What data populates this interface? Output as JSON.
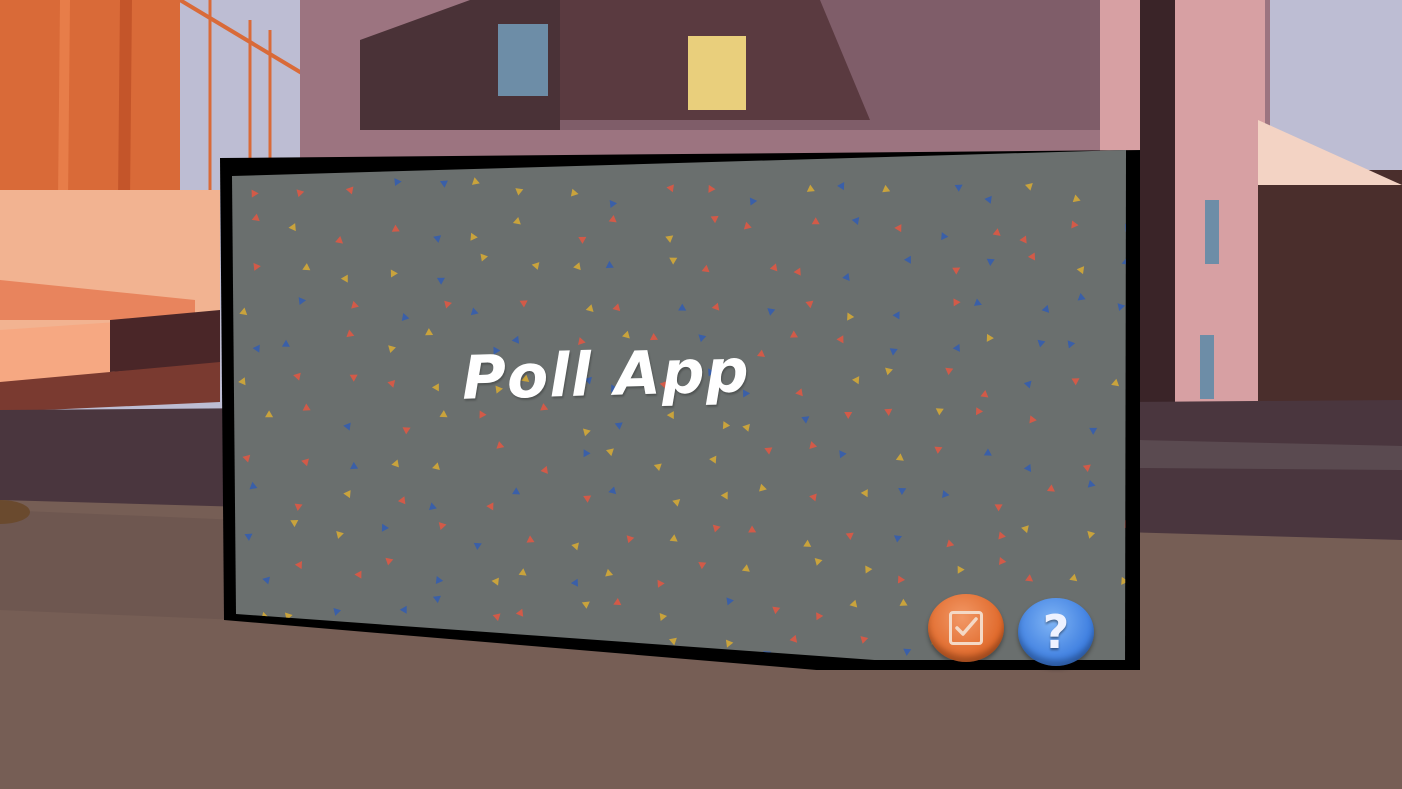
{
  "app": {
    "title": "Poll App"
  },
  "buttons": {
    "poll_icon": "checkbox-icon",
    "help_icon": "question-mark-icon",
    "help_glyph": "?"
  },
  "colors": {
    "screen": "#6a6f6e",
    "frame": "#000000",
    "poll_button": "#e06a2c",
    "help_button": "#3f7fe0",
    "confetti_red": "#d25a48",
    "confetti_blue": "#3a5fa8",
    "confetti_yellow": "#c9a33c"
  }
}
